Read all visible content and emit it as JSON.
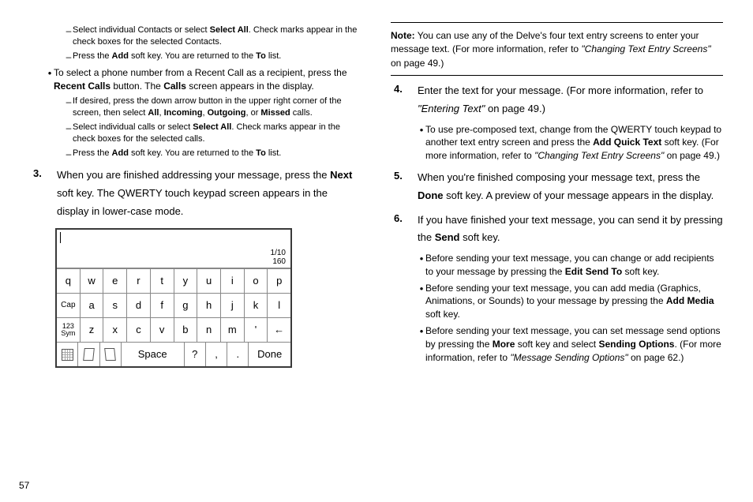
{
  "page_number": "57",
  "left": {
    "d1": "Select individual Contacts or select ",
    "d1b": "Select All",
    "d1c": ". Check marks appear in the check boxes for the selected Contacts.",
    "d2": "Press the ",
    "d2b": "Add",
    "d2c": " soft key. You are returned to the ",
    "d2d": "To",
    "d2e": " list.",
    "bul1": "To select a phone number from a Recent Call as a recipient, press the ",
    "bul1b": "Recent Calls",
    "bul1c": " button. The ",
    "bul1d": "Calls",
    "bul1e": " screen appears in the display.",
    "d3": "If desired, press the down arrow button in the upper right corner of the screen, then select ",
    "d3all": "All",
    "d3com1": ", ",
    "d3inc": "Incoming",
    "d3com2": ", ",
    "d3out": "Outgoing",
    "d3com3": ", or ",
    "d3mis": "Missed",
    "d3end": " calls.",
    "d4": "Select individual calls or select ",
    "d4b": "Select All",
    "d4c": ". Check marks appear in the check boxes for the selected calls.",
    "d5": "Press the ",
    "d5b": "Add",
    "d5c": " soft key. You are returned to the ",
    "d5d": "To",
    "d5e": " list.",
    "step3num": "3.",
    "step3a": "When you are finished addressing your message, press the ",
    "step3b": "Next",
    "step3c": " soft key. The QWERTY touch keypad screen appears in the display in lower-case mode."
  },
  "keypad": {
    "counter1": "1/10",
    "counter2": "160",
    "row1": [
      "q",
      "w",
      "e",
      "r",
      "t",
      "y",
      "u",
      "i",
      "o",
      "p"
    ],
    "row2": [
      "Cap",
      "a",
      "s",
      "d",
      "f",
      "g",
      "h",
      "j",
      "k",
      "l"
    ],
    "row3": [
      "123\nSym",
      "z",
      "x",
      "c",
      "v",
      "b",
      "n",
      "m",
      "'",
      "←"
    ],
    "row4": [
      "grid",
      "pg1",
      "pg2",
      "Space",
      "?",
      ",",
      ".",
      "Done"
    ]
  },
  "right": {
    "note_label": "Note:",
    "note_body": " You can use any of the Delve's four text entry screens to enter your message text. (For more information, refer to ",
    "note_ref": "\"Changing Text Entry Screens\"",
    "note_end": "  on page 49.)",
    "step4num": "4.",
    "step4a": "Enter the text for your message. (For more information, refer to ",
    "step4ref": "\"Entering Text\"",
    "step4b": "  on page 49.)",
    "b4a": "To use pre-composed text, change from the QWERTY touch keypad to another text entry screen and press the ",
    "b4b": "Add Quick Text",
    "b4c": " soft key. (For more information, refer to ",
    "b4ref": "\"Changing Text Entry Screens\"",
    "b4d": "  on page 49.)",
    "step5num": "5.",
    "step5a": "When you're finished composing your message text, press the ",
    "step5b": "Done",
    "step5c": " soft key. A preview of your message appears in the display.",
    "step6num": "6.",
    "step6a": "If you have finished your text message, you can send it by pressing the ",
    "step6b": "Send",
    "step6c": " soft key.",
    "b6a": "Before sending your text message, you can change or add recipients to your message by pressing the ",
    "b6ab": "Edit Send To",
    "b6ac": " soft key.",
    "b6b": "Before sending your text message, you can add media (Graphics, Animations, or Sounds) to your message by pressing the ",
    "b6bb": "Add Media",
    "b6bc": " soft key.",
    "b6c": "Before sending your text message, you can set message send options by pressing the ",
    "b6cb": "More",
    "b6cc": " soft key and select ",
    "b6cd": "Sending Options",
    "b6ce": ". (For more information, refer to ",
    "b6cref": "\"Message Sending Options\"",
    "b6cend": "  on page 62.)"
  }
}
